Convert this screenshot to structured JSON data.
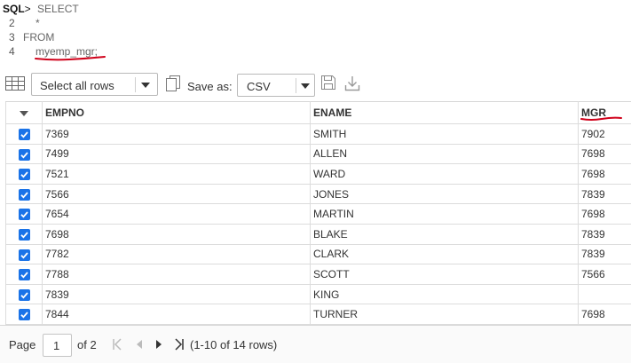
{
  "editor": {
    "prompt": "SQL",
    "lines": [
      {
        "num": "",
        "text": "SELECT"
      },
      {
        "num": "2",
        "text": "*"
      },
      {
        "num": "3",
        "text": "FROM"
      },
      {
        "num": "4",
        "text": "myemp_mgr;"
      }
    ]
  },
  "toolbar": {
    "select_rows": "Select all rows",
    "save_as_label": "Save as:",
    "format": "CSV"
  },
  "table": {
    "columns": [
      "EMPNO",
      "ENAME",
      "MGR"
    ],
    "rows": [
      [
        "7369",
        "SMITH",
        "7902"
      ],
      [
        "7499",
        "ALLEN",
        "7698"
      ],
      [
        "7521",
        "WARD",
        "7698"
      ],
      [
        "7566",
        "JONES",
        "7839"
      ],
      [
        "7654",
        "MARTIN",
        "7698"
      ],
      [
        "7698",
        "BLAKE",
        "7839"
      ],
      [
        "7782",
        "CLARK",
        "7839"
      ],
      [
        "7788",
        "SCOTT",
        "7566"
      ],
      [
        "7839",
        "KING",
        ""
      ],
      [
        "7844",
        "TURNER",
        "7698"
      ]
    ]
  },
  "pager": {
    "page_label": "Page",
    "page_value": "1",
    "of_label": "of 2",
    "range": "(1-10 of 14 rows)"
  },
  "colors": {
    "checkbox": "#1a73e8",
    "annotation": "#d0021b"
  }
}
